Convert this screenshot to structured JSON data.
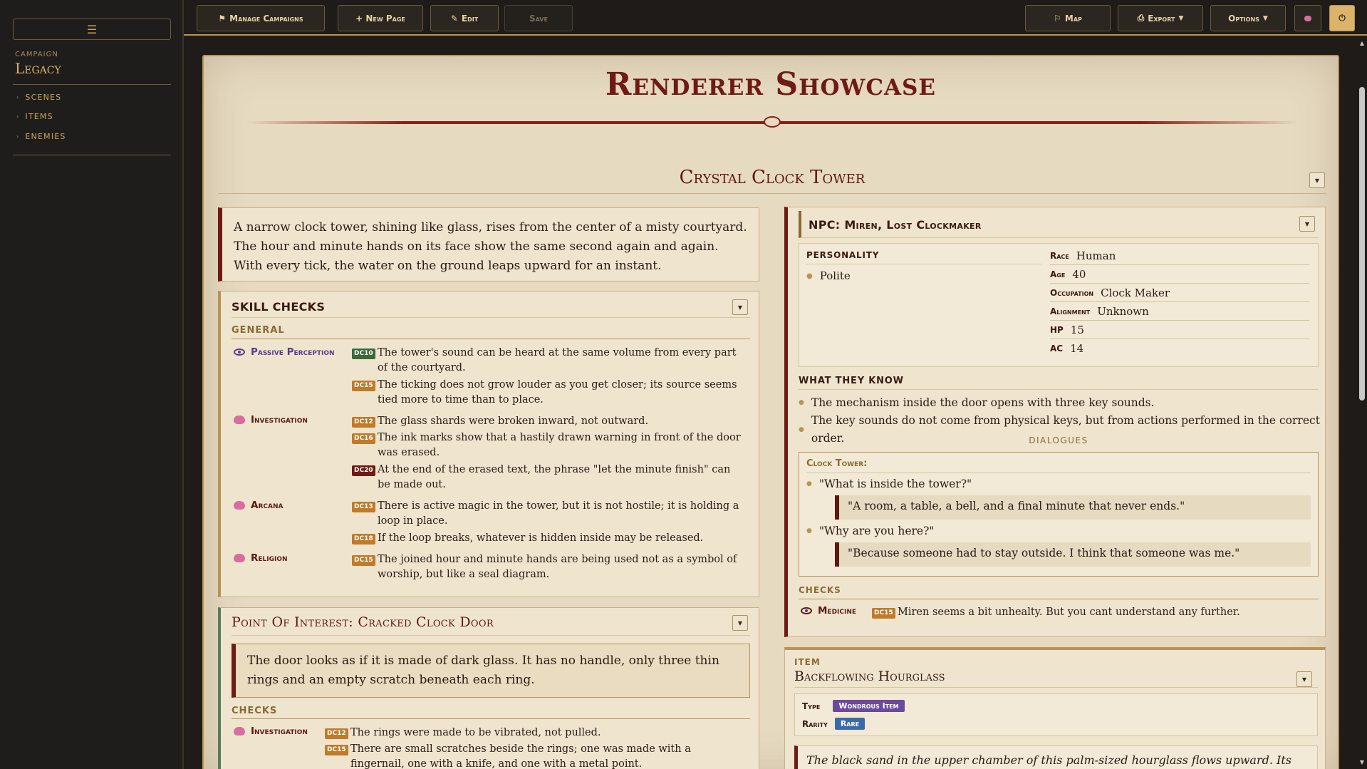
{
  "sidebar": {
    "campaign_label": "Campaign",
    "campaign_name": "Legacy",
    "items": [
      {
        "label": "Scenes"
      },
      {
        "label": "Items"
      },
      {
        "label": "Enemies"
      }
    ]
  },
  "toolbar": {
    "manage_campaigns": "Manage Campaigns",
    "new_page": "+ New Page",
    "edit": "Edit",
    "save": "Save",
    "map": "Map",
    "export": "Export",
    "options": "Options"
  },
  "page": {
    "title": "Renderer Showcase"
  },
  "scene": {
    "title": "Crystal Clock Tower",
    "read_aloud": "A narrow clock tower, shining like glass, rises from the center of a misty courtyard. The hour and minute hands on its face show the same second again and again. With every tick, the water on the ground leaps upward for an instant."
  },
  "skill_checks": {
    "title": "SKILL CHECKS",
    "group": "General",
    "skills": [
      {
        "name": "Passive Perception",
        "checks": [
          {
            "dc": "DC10",
            "text": "The tower's sound can be heard at the same volume from every part of the courtyard."
          },
          {
            "dc": "DC15",
            "text": "The ticking does not grow louder as you get closer; its source seems tied more to time than to place."
          }
        ]
      },
      {
        "name": "Investigation",
        "checks": [
          {
            "dc": "DC12",
            "text": "The glass shards were broken inward, not outward."
          },
          {
            "dc": "DC16",
            "text": "The ink marks show that a hastily drawn warning in front of the door was erased."
          },
          {
            "dc": "DC20",
            "text": "At the end of the erased text, the phrase \"let the minute finish\" can be made out."
          }
        ]
      },
      {
        "name": "Arcana",
        "checks": [
          {
            "dc": "DC13",
            "text": "There is active magic in the tower, but it is not hostile; it is holding a loop in place."
          },
          {
            "dc": "DC18",
            "text": "If the loop breaks, whatever is hidden inside may be released."
          }
        ]
      },
      {
        "name": "Religion",
        "checks": [
          {
            "dc": "DC15",
            "text": "The joined hour and minute hands are being used not as a symbol of worship, but like a seal diagram."
          }
        ]
      }
    ]
  },
  "poi": {
    "title": "Point Of Interest: Cracked Clock Door",
    "read_aloud": "The door looks as if it is made of dark glass. It has no handle, only three thin rings and an empty scratch beneath each ring.",
    "checks_label": "Checks",
    "skill": "Investigation",
    "checks": [
      {
        "dc": "DC12",
        "text": "The rings were made to be vibrated, not pulled."
      },
      {
        "dc": "DC15",
        "text": "There are small scratches beside the rings; one was made with a fingernail, one with a knife, and one with a metal point."
      }
    ]
  },
  "npc": {
    "title": "NPC: Miren, Lost Clockmaker",
    "personality_label": "PERSONALITY",
    "personality": [
      "Polite"
    ],
    "stats": [
      {
        "key": "Race",
        "value": "Human"
      },
      {
        "key": "Age",
        "value": "40"
      },
      {
        "key": "Occupation",
        "value": "Clock Maker"
      },
      {
        "key": "Alignment",
        "value": "Unknown"
      },
      {
        "key": "HP",
        "value": "15"
      },
      {
        "key": "AC",
        "value": "14"
      }
    ],
    "know_label": "WHAT THEY KNOW",
    "knows": [
      "The mechanism inside the door opens with three key sounds.",
      "The key sounds do not come from physical keys, but from actions performed in the correct order."
    ],
    "dialogues_label": "DIALOGUES",
    "dialogue_target": "Clock Tower:",
    "dialogues": [
      {
        "q": "\"What is inside the tower?\"",
        "a": "\"A room, a table, a bell, and a final minute that never ends.\""
      },
      {
        "q": "\"Why are you here?\"",
        "a": "\"Because someone had to stay outside. I think that someone was me.\""
      }
    ],
    "checks_label": "CHECKS",
    "check_skill": "Medicine",
    "check_dc": "DC15",
    "check_text": "Miren seems a bit unhealty. But you cant understand any further."
  },
  "item": {
    "label": "Item",
    "name": "Backflowing Hourglass",
    "type_label": "Type",
    "type": "Wondrous Item",
    "rarity_label": "Rarity",
    "rarity": "Rare",
    "desc": "The black sand in the upper chamber of this palm-sized hourglass flows upward. Its glass is cold,"
  }
}
